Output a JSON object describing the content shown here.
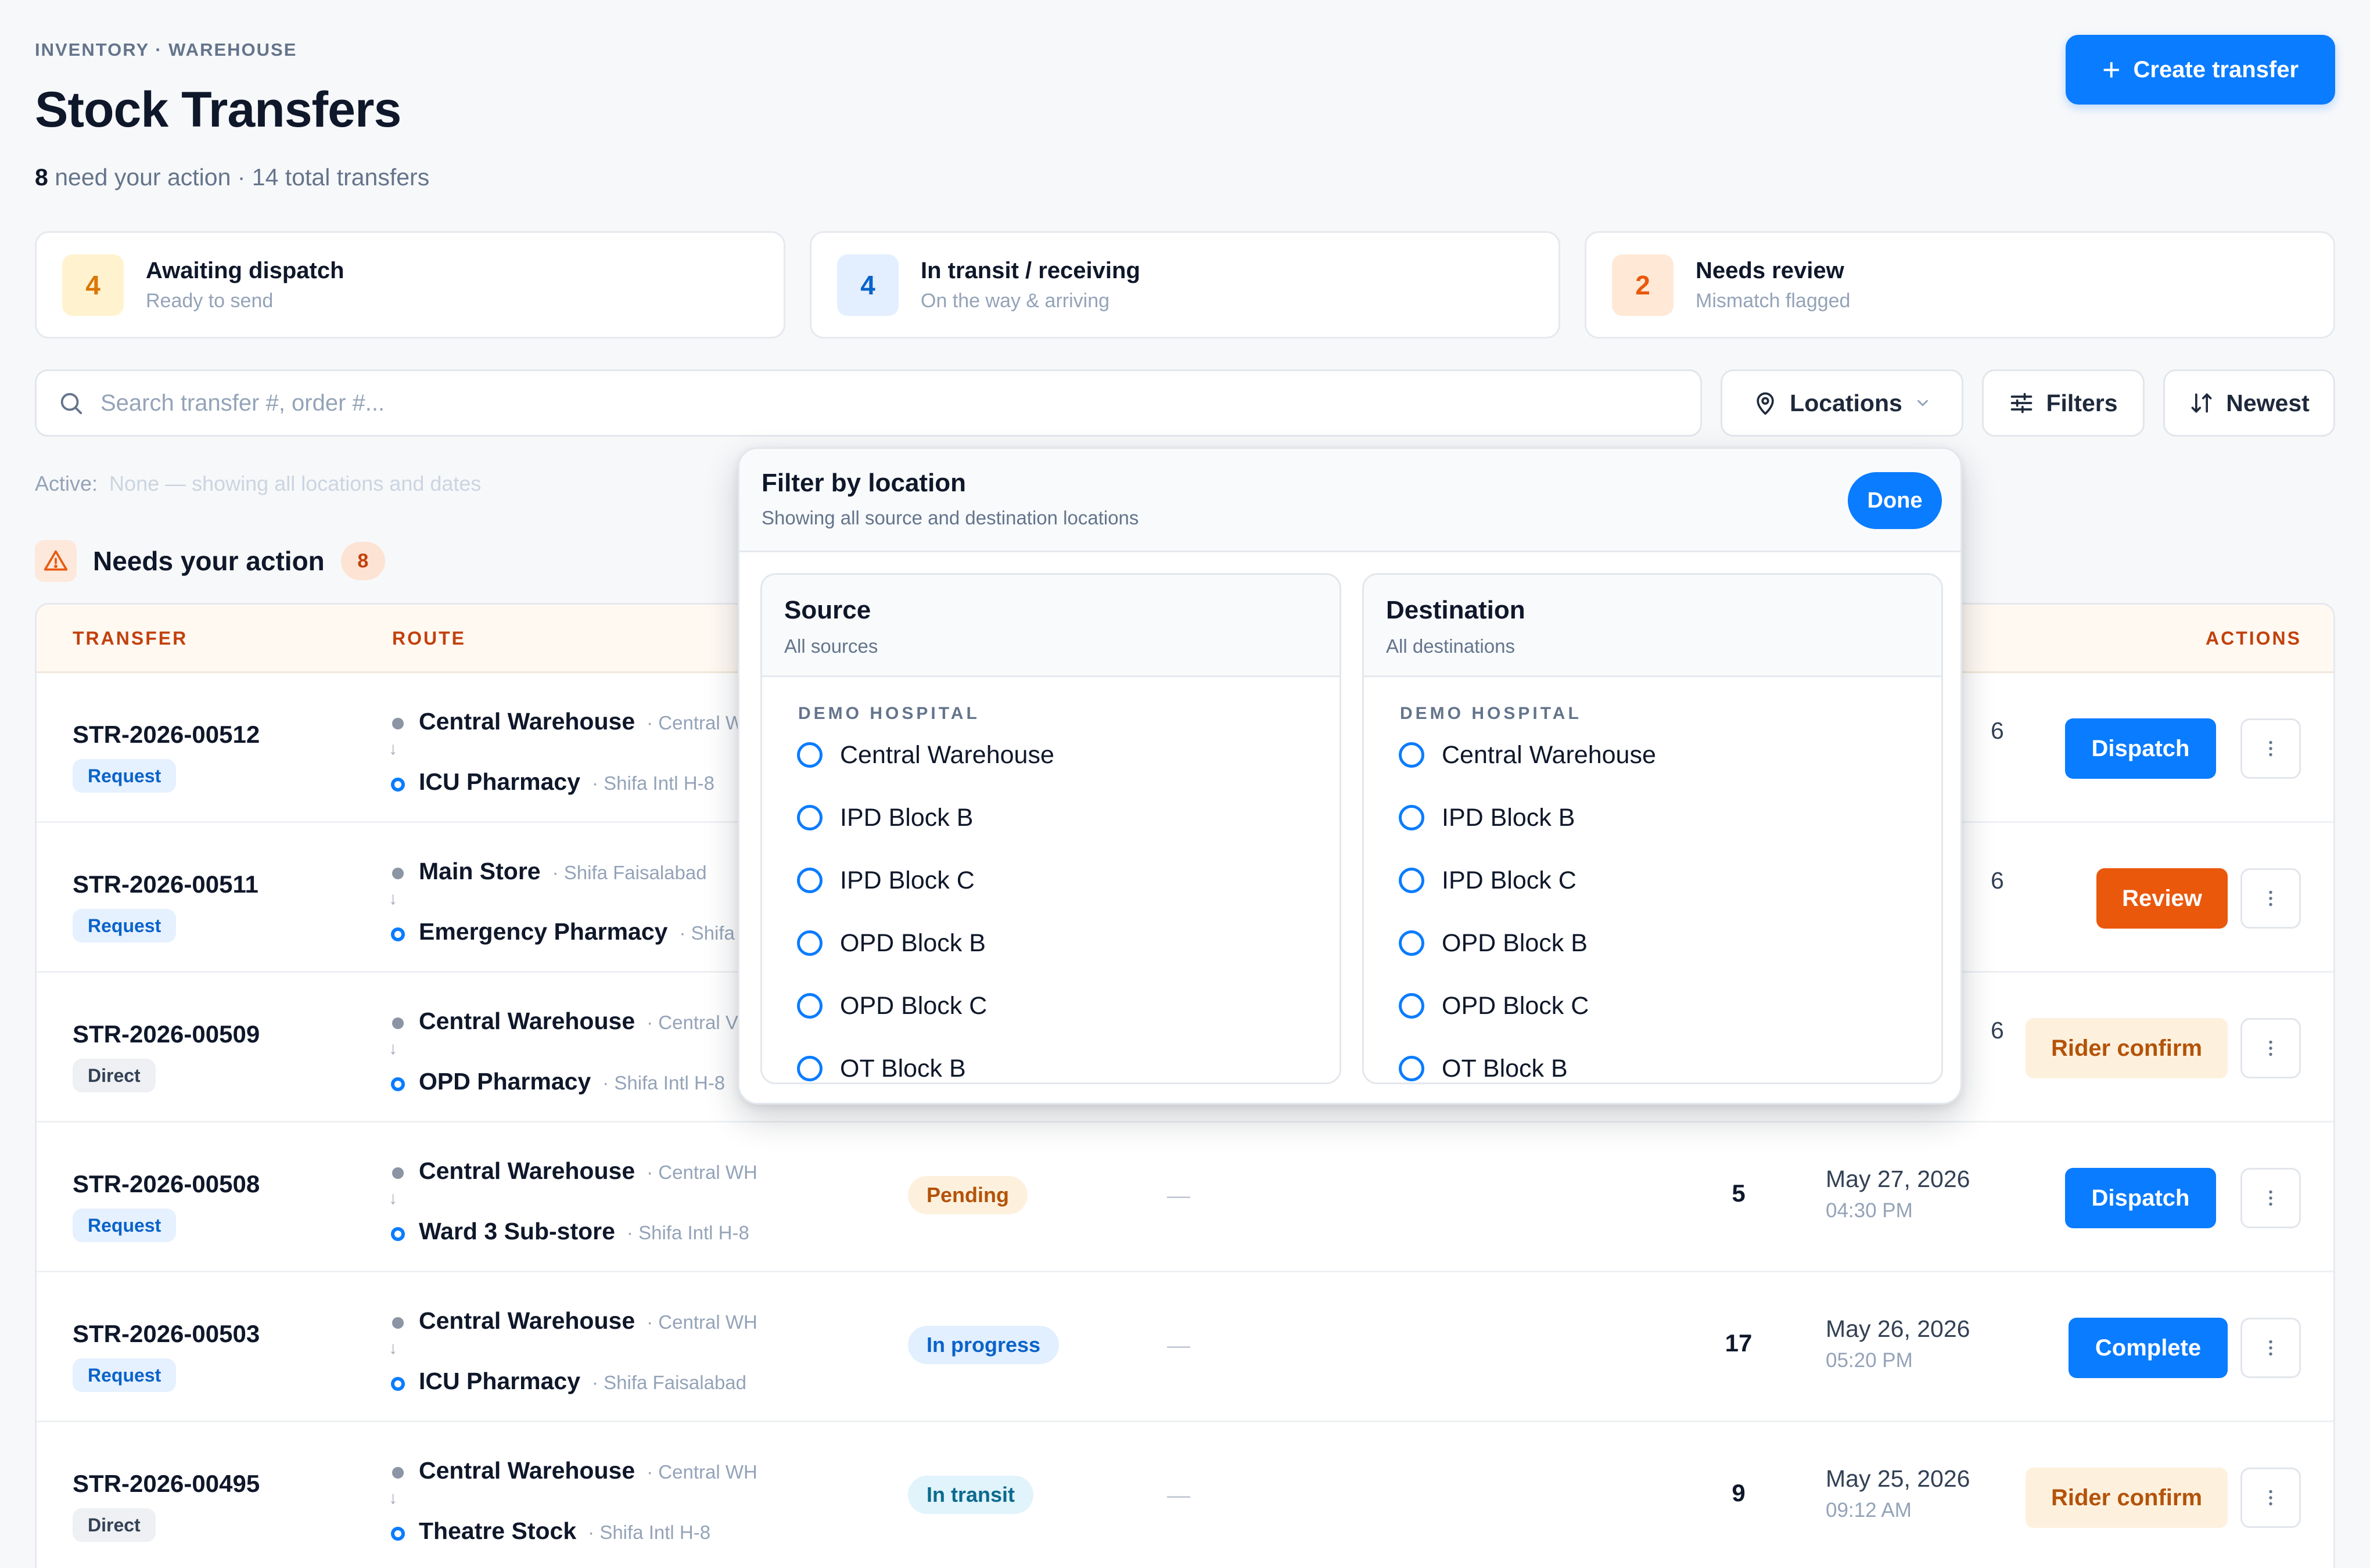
{
  "header": {
    "breadcrumb": "INVENTORY · WAREHOUSE",
    "title": "Stock Transfers",
    "action_count": "8",
    "subtitle_rest": "need your action · 14 total transfers",
    "create_label": "Create transfer"
  },
  "stats": [
    {
      "num": "4",
      "title": "Awaiting dispatch",
      "sub": "Ready to send",
      "bg": "#fff3cf",
      "fg": "#d97706"
    },
    {
      "num": "4",
      "title": "In transit / receiving",
      "sub": "On the way & arriving",
      "bg": "#e3efff",
      "fg": "#0a63c9"
    },
    {
      "num": "2",
      "title": "Needs review",
      "sub": "Mismatch flagged",
      "bg": "#ffe9d6",
      "fg": "#ea580c"
    }
  ],
  "toolbar": {
    "search_placeholder": "Search transfer #, order #...",
    "locations_label": "Locations",
    "filters_label": "Filters",
    "sort_label": "Newest"
  },
  "active": {
    "label": "Active:",
    "value": "None — showing all locations and dates"
  },
  "section": {
    "title": "Needs your action",
    "count": "8"
  },
  "table": {
    "headers": {
      "transfer": "TRANSFER",
      "route": "ROUTE",
      "actions": "ACTIONS"
    },
    "rows": [
      {
        "id": "STR-2026-00512",
        "type": "Request",
        "from": "Central Warehouse",
        "from_sub": "· Central W",
        "to": "ICU Pharmacy",
        "to_sub": "· Shifa Intl H-8",
        "status": "",
        "status_kind": "",
        "qty": "",
        "date": "",
        "time": "",
        "action": "Dispatch",
        "action_kind": "primary"
      },
      {
        "id": "STR-2026-00511",
        "type": "Request",
        "from": "Main Store",
        "from_sub": "· Shifa Faisalabad",
        "to": "Emergency Pharmacy",
        "to_sub": "· Shifa",
        "status": "",
        "status_kind": "",
        "qty": "",
        "date": "",
        "time": "",
        "action": "Review",
        "action_kind": "orange"
      },
      {
        "id": "STR-2026-00509",
        "type": "Direct",
        "from": "Central Warehouse",
        "from_sub": "· Central V",
        "to": "OPD Pharmacy",
        "to_sub": "· Shifa Intl H-8",
        "status": "",
        "status_kind": "",
        "qty": "",
        "date": "",
        "time": "",
        "action": "Rider confirm",
        "action_kind": "soft"
      },
      {
        "id": "STR-2026-00508",
        "type": "Request",
        "from": "Central Warehouse",
        "from_sub": "· Central WH",
        "to": "Ward 3 Sub-store",
        "to_sub": "· Shifa Intl H-8",
        "status": "Pending",
        "status_kind": "pending",
        "dash": "—",
        "qty": "5",
        "date": "May 27, 2026",
        "time": "04:30 PM",
        "action": "Dispatch",
        "action_kind": "primary"
      },
      {
        "id": "STR-2026-00503",
        "type": "Request",
        "from": "Central Warehouse",
        "from_sub": "· Central WH",
        "to": "ICU Pharmacy",
        "to_sub": "· Shifa Faisalabad",
        "status": "In progress",
        "status_kind": "progress",
        "dash": "—",
        "qty": "17",
        "date": "May 26, 2026",
        "time": "05:20 PM",
        "action": "Complete",
        "action_kind": "primary"
      },
      {
        "id": "STR-2026-00495",
        "type": "Direct",
        "from": "Central Warehouse",
        "from_sub": "· Central WH",
        "to": "Theatre Stock",
        "to_sub": "· Shifa Intl H-8",
        "status": "In transit",
        "status_kind": "transit",
        "dash": "—",
        "qty": "9",
        "date": "May 25, 2026",
        "time": "09:12 AM",
        "action": "Rider confirm",
        "action_kind": "soft"
      }
    ],
    "peek": [
      "6",
      "6",
      "6"
    ]
  },
  "popover": {
    "title": "Filter by location",
    "subtitle": "Showing all source and destination locations",
    "done_label": "Done",
    "source": {
      "title": "Source",
      "sub": "All sources",
      "group": "DEMO HOSPITAL",
      "options": [
        "Central Warehouse",
        "IPD Block B",
        "IPD Block C",
        "OPD Block B",
        "OPD Block C",
        "OT Block B"
      ]
    },
    "destination": {
      "title": "Destination",
      "sub": "All destinations",
      "group": "DEMO HOSPITAL",
      "options": [
        "Central Warehouse",
        "IPD Block B",
        "IPD Block C",
        "OPD Block B",
        "OPD Block C",
        "OT Block B"
      ]
    }
  }
}
